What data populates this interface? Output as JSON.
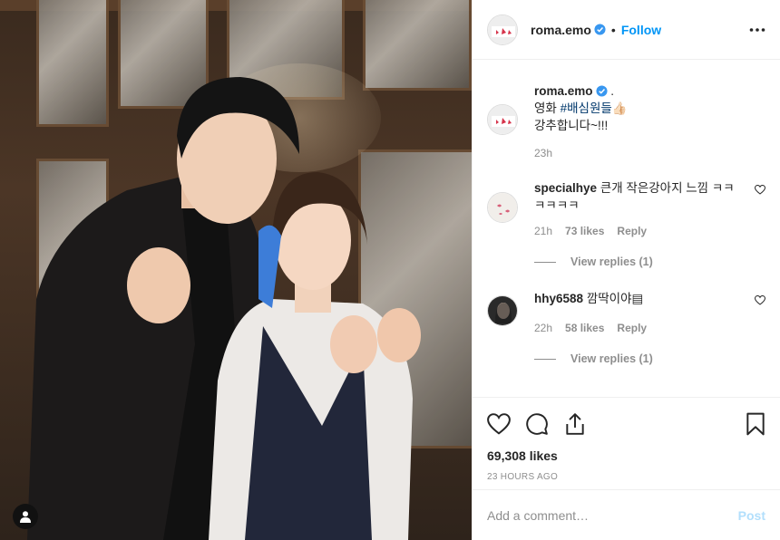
{
  "post": {
    "author": "roma.emo",
    "follow_label": "Follow",
    "dot": "•",
    "caption_line1_suffix": " .",
    "caption_line2_prefix": "영화 ",
    "caption_hashtag": "#배심원들",
    "caption_emoji": "👍🏻",
    "caption_line3": "강추합니다~!!!",
    "caption_time": "23h",
    "likes_total": "69,308 likes",
    "time_ago": "23 hours ago"
  },
  "comments": [
    {
      "user": "specialhye",
      "text": "큰개 작은강아지 느낌 ㅋㅋㅋㅋㅋㅋ",
      "time": "21h",
      "likes": "73 likes",
      "reply_label": "Reply",
      "view_replies": "View replies (1)"
    },
    {
      "user": "hhy6588",
      "text": "깜딱이야▤",
      "time": "22h",
      "likes": "58 likes",
      "reply_label": "Reply",
      "view_replies": "View replies (1)"
    }
  ],
  "add_comment": {
    "placeholder": "Add a comment…",
    "post_label": "Post"
  },
  "icons": {
    "like": "heart-icon",
    "comment": "comment-icon",
    "share": "share-icon",
    "save": "bookmark-icon",
    "more": "more-options-icon",
    "verified": "verified-badge-icon",
    "tag": "user-tag-icon"
  },
  "colors": {
    "link": "#0095f6",
    "verified": "#3897f0",
    "post_disabled": "#b2dffc",
    "muted": "#8e8e8e"
  }
}
